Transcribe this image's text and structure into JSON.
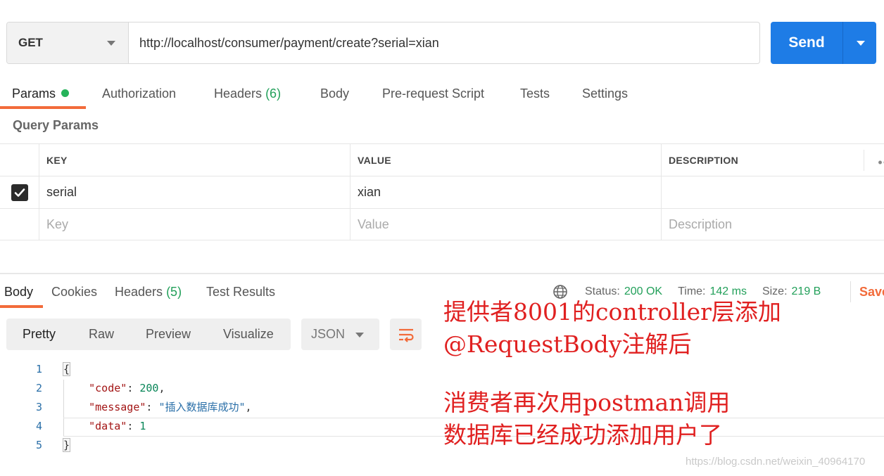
{
  "request": {
    "method": "GET",
    "url": "http://localhost/consumer/payment/create?serial=xian",
    "send_label": "Send"
  },
  "request_tabs": [
    {
      "label": "Params",
      "active": true,
      "dot": true
    },
    {
      "label": "Authorization"
    },
    {
      "label": "Headers",
      "count": "(6)"
    },
    {
      "label": "Body"
    },
    {
      "label": "Pre-request Script"
    },
    {
      "label": "Tests"
    },
    {
      "label": "Settings"
    }
  ],
  "query_params": {
    "title": "Query Params",
    "headers": {
      "key": "KEY",
      "value": "VALUE",
      "description": "DESCRIPTION"
    },
    "rows": [
      {
        "checked": true,
        "key": "serial",
        "value": "xian",
        "description": ""
      }
    ],
    "placeholders": {
      "key": "Key",
      "value": "Value",
      "description": "Description"
    },
    "more": "••"
  },
  "response": {
    "tabs": [
      {
        "label": "Body",
        "active": true
      },
      {
        "label": "Cookies"
      },
      {
        "label": "Headers",
        "count": "(5)"
      },
      {
        "label": "Test Results"
      }
    ],
    "status_label": "Status:",
    "status_value": "200 OK",
    "time_label": "Time:",
    "time_value": "142 ms",
    "size_label": "Size:",
    "size_value": "219 B",
    "save_label": "Save",
    "view_modes": [
      "Pretty",
      "Raw",
      "Preview",
      "Visualize"
    ],
    "format": "JSON",
    "lines": [
      "1",
      "2",
      "3",
      "4",
      "5"
    ],
    "json": {
      "open": "{",
      "close": "}",
      "code_key": "\"code\"",
      "code_val": "200",
      "message_key": "\"message\"",
      "message_val": "\"插入数据库成功\"",
      "data_key": "\"data\"",
      "data_val": "1"
    }
  },
  "annotation": {
    "line1": "提供者8001的controller层添加",
    "line2": "@RequestBody注解后",
    "line3": "消费者再次用postman调用",
    "line4": "数据库已经成功添加用户了"
  },
  "watermark": "https://blog.csdn.net/weixin_40964170",
  "colors": {
    "accent": "#f26b3a",
    "send": "#1e7ce6",
    "ok": "#22a05a",
    "annotation": "#e02020"
  }
}
